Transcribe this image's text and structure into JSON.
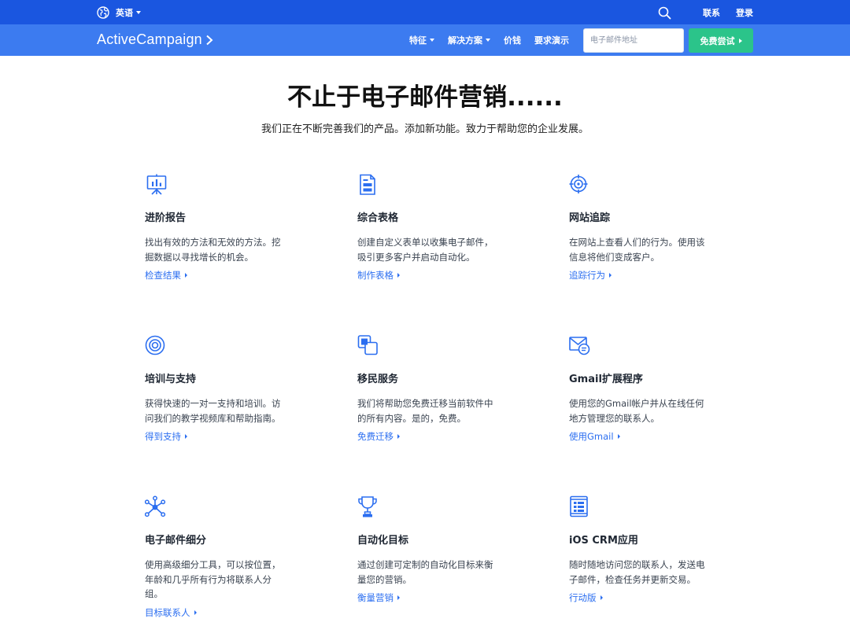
{
  "topbar": {
    "language": "英语",
    "contact": "联系",
    "login": "登录"
  },
  "navbar": {
    "logo": "ActiveCampaign",
    "links": [
      {
        "label": "特征",
        "dropdown": true
      },
      {
        "label": "解决方案",
        "dropdown": true
      },
      {
        "label": "价钱",
        "dropdown": false
      },
      {
        "label": "要求演示",
        "dropdown": false
      }
    ],
    "email_placeholder": "电子邮件地址",
    "trial_label": "免费尝试"
  },
  "hero": {
    "title": "不止于电子邮件营销......",
    "subtitle": "我们正在不断完善我们的产品。添加新功能。致力于帮助您的企业发展。"
  },
  "features": [
    {
      "icon": "presentation-chart-icon",
      "title": "进阶报告",
      "desc": "找出有效的方法和无效的方法。挖掘数据以寻找增长的机会。",
      "link": "检查结果"
    },
    {
      "icon": "form-document-icon",
      "title": "综合表格",
      "desc": "创建自定义表单以收集电子邮件，吸引更多客户并启动自动化。",
      "link": "制作表格"
    },
    {
      "icon": "target-crosshair-icon",
      "title": "网站追踪",
      "desc": "在网站上查看人们的行为。使用该信息将他们变成客户。",
      "link": "追踪行为"
    },
    {
      "icon": "lifebuoy-icon",
      "title": "培训与支持",
      "desc": "获得快速的一对一支持和培训。访问我们的教学视频库和帮助指南。",
      "link": "得到支持"
    },
    {
      "icon": "migration-boxes-icon",
      "title": "移民服务",
      "desc": "我们将帮助您免费迁移当前软件中的所有内容。是的，免费。",
      "link": "免费迁移"
    },
    {
      "icon": "envelope-chat-icon",
      "title": "Gmail扩展程序",
      "desc": "使用您的Gmail帐户并从在线任何地方管理您的联系人。",
      "link": "使用Gmail"
    },
    {
      "icon": "network-nodes-icon",
      "title": "电子邮件细分",
      "desc": "使用高级细分工具，可以按位置，年龄和几乎所有行为将联系人分组。",
      "link": "目标联系人"
    },
    {
      "icon": "trophy-icon",
      "title": "自动化目标",
      "desc": "通过创建可定制的自动化目标来衡量您的营销。",
      "link": "衡量营销"
    },
    {
      "icon": "mobile-app-icon",
      "title": "iOS CRM应用",
      "desc": "随时随地访问您的联系人，发送电子邮件，检查任务并更新交易。",
      "link": "行动版"
    }
  ]
}
